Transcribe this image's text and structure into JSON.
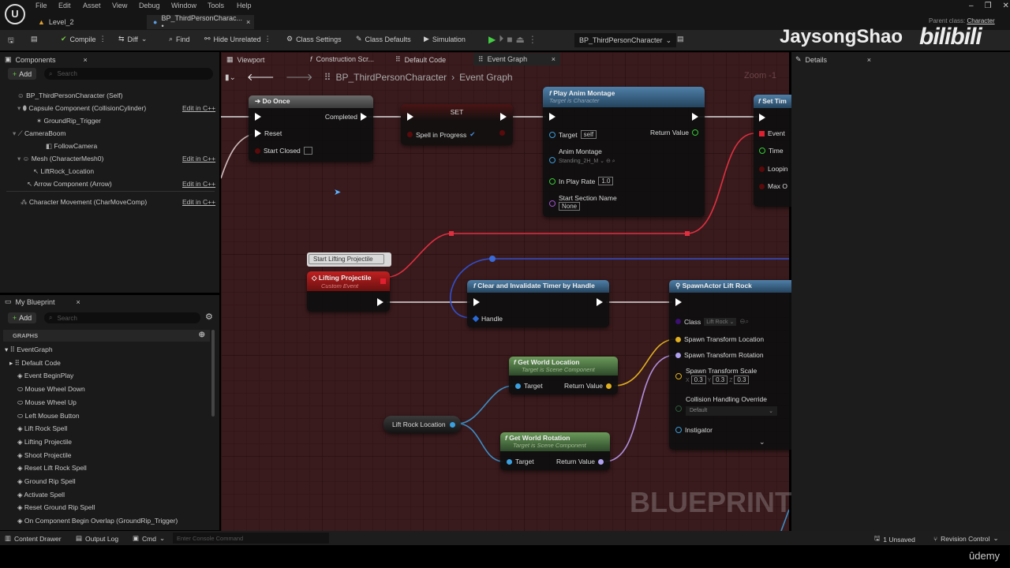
{
  "menu": [
    "File",
    "Edit",
    "Asset",
    "View",
    "Debug",
    "Window",
    "Tools",
    "Help"
  ],
  "doc_tabs": [
    {
      "label": "Level_2"
    },
    {
      "label": "BP_ThirdPersonCharac... •"
    }
  ],
  "parent_class": {
    "label": "Parent class:",
    "value": "Character"
  },
  "watermark": {
    "author": "JaysongShao",
    "logo": "bilibili",
    "graph": "BLUEPRINT",
    "platform": "ûdemy"
  },
  "toolbar": {
    "compile": "Compile",
    "diff": "Diff",
    "find": "Find",
    "hide_unrelated": "Hide Unrelated",
    "class_settings": "Class Settings",
    "class_defaults": "Class Defaults",
    "simulation": "Simulation",
    "debug_object": "BP_ThirdPersonCharacter"
  },
  "components": {
    "tab": "Components",
    "add": "Add",
    "search_placeholder": "Search",
    "items": [
      {
        "label": "BP_ThirdPersonCharacter (Self)",
        "edit": ""
      },
      {
        "label": "Capsule Component (CollisionCylinder)",
        "edit": "Edit in C++"
      },
      {
        "label": "GroundRip_Trigger",
        "edit": ""
      },
      {
        "label": "CameraBoom",
        "edit": ""
      },
      {
        "label": "FollowCamera",
        "edit": ""
      },
      {
        "label": "Mesh (CharacterMesh0)",
        "edit": "Edit in C++"
      },
      {
        "label": "LiftRock_Location",
        "edit": ""
      },
      {
        "label": "Arrow Component (Arrow)",
        "edit": "Edit in C++"
      },
      {
        "label": "Character Movement (CharMoveComp)",
        "edit": "Edit in C++"
      }
    ]
  },
  "my_blueprint": {
    "tab": "My Blueprint",
    "add": "Add",
    "search_placeholder": "Search",
    "section": "GRAPHS",
    "items": [
      "EventGraph",
      "Default Code",
      "Event BeginPlay",
      "Mouse Wheel Down",
      "Mouse Wheel Up",
      "Left Mouse Button",
      "Lift Rock Spell",
      "Lifting Projectile",
      "Shoot Projectile",
      "Reset Lift Rock Spell",
      "Ground Rip Spell",
      "Activate Spell",
      "Reset Ground Rip Spell",
      "On Component Begin Overlap (GroundRip_Trigger)"
    ]
  },
  "graph_tabs": [
    "Viewport",
    "Construction Scr...",
    "Default Code",
    "Event Graph"
  ],
  "breadcrumb": {
    "blueprint": "BP_ThirdPersonCharacter",
    "graph": "Event Graph"
  },
  "zoom": "Zoom -1",
  "details": {
    "tab": "Details"
  },
  "nodes": {
    "do_once": {
      "title": "Do Once",
      "completed": "Completed",
      "reset": "Reset",
      "start_closed": "Start Closed"
    },
    "set": {
      "title": "SET",
      "var": "Spell in Progress",
      "checked": true
    },
    "play_anim": {
      "title": "Play Anim Montage",
      "subtitle": "Target is Character",
      "target": "Target",
      "target_val": "self",
      "return": "Return Value",
      "montage": "Anim Montage",
      "montage_val": "Standing_2H_M",
      "rate": "In Play Rate",
      "rate_val": "1.0",
      "section": "Start Section Name",
      "section_val": "None"
    },
    "set_timer": {
      "title": "Set Tim",
      "event": "Event",
      "time": "Time",
      "looping": "Loopin",
      "max": "Max O"
    },
    "comment": "Start Lifting Projectile",
    "lifting": {
      "title": "Lifting Projectile",
      "subtitle": "Custom Event"
    },
    "clear_timer": {
      "title": "Clear and Invalidate Timer by Handle",
      "handle": "Handle"
    },
    "spawn": {
      "title": "SpawnActor Lift Rock",
      "class": "Class",
      "class_val": "Lift Rock",
      "loc": "Spawn Transform Location",
      "rot": "Spawn Transform Rotation",
      "scale": "Spawn Transform Scale",
      "x": "0.3",
      "y": "0.3",
      "z": "0.3",
      "collision": "Collision Handling Override",
      "collision_val": "Default",
      "instigator": "Instigator"
    },
    "get_loc": {
      "title": "Get World Location",
      "subtitle": "Target is Scene Component",
      "target": "Target",
      "return": "Return Value"
    },
    "get_rot": {
      "title": "Get World Rotation",
      "subtitle": "Target is Scene Component",
      "target": "Target",
      "return": "Return Value"
    },
    "lift_rock_var": "Lift Rock Location"
  },
  "status": {
    "content_drawer": "Content Drawer",
    "output_log": "Output Log",
    "cmd": "Cmd",
    "console_placeholder": "Enter Console Command",
    "unsaved": "1 Unsaved",
    "revision": "Revision Control"
  }
}
